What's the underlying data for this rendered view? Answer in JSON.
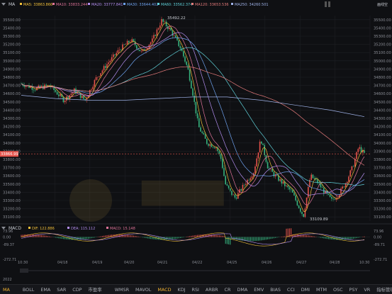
{
  "legend": {
    "indicator": "MA",
    "items": [
      {
        "label": "MA5: 33863.866",
        "color": "#f3c03a"
      },
      {
        "label": "MA10: 33833.244",
        "color": "#e1749a"
      },
      {
        "label": "MA20: 33777.841",
        "color": "#b48ef0"
      },
      {
        "label": "MA30: 33644.402",
        "color": "#6fa3f0"
      },
      {
        "label": "MA60: 33562.374",
        "color": "#5fd0d8"
      },
      {
        "label": "MA120: 33653.536",
        "color": "#e57b7b"
      },
      {
        "label": "MA250: 34260.501",
        "color": "#9fb2e8"
      }
    ],
    "right_btn": "画线空"
  },
  "price_axis": [
    "35500.00",
    "35400.00",
    "35300.00",
    "35200.00",
    "35100.00",
    "35000.00",
    "34900.00",
    "34800.00",
    "34700.00",
    "34600.00",
    "34500.00",
    "34400.00",
    "34300.00",
    "34200.00",
    "34100.00",
    "34000.00",
    "33900.00",
    "33800.00",
    "33700.00",
    "33600.00",
    "33500.00",
    "33400.00",
    "33300.00",
    "33200.00",
    "33100.00"
  ],
  "current_price": "33866.99",
  "annotations": {
    "high": "35492.22",
    "low": "33109.89"
  },
  "macd_legend": {
    "name": "MACD",
    "dif": "DIF: 122.886",
    "dea": "DEA: 115.112",
    "macd": "MACD: 15.148",
    "colors": {
      "dif": "#f3c03a",
      "dea": "#b48ef0",
      "macd": "#e1749a"
    }
  },
  "macd_axis_right": [
    "73.96",
    "0.00",
    "-89.71"
  ],
  "macd_axis_left": [
    "73.96",
    "0.00",
    "-89.37",
    "-272.71"
  ],
  "macd_axis_bottom_right": "-272.71",
  "time_axis": [
    "10:30",
    "04/18",
    "04/19",
    "04/20",
    "04/21",
    "04/22",
    "04/25",
    "04/26",
    "04/27",
    "04/28",
    "10:30"
  ],
  "year_label": "2022",
  "toolbar": {
    "items": [
      "MA",
      "BOLL",
      "EMA",
      "SAR",
      "CDP",
      "市盈率",
      "WMSR",
      "MAVOL",
      "MACD",
      "KDJ",
      "RSI",
      "ARBR",
      "CR",
      "DMA",
      "EMV",
      "BIAS",
      "CCI",
      "DMI",
      "MTM",
      "OSC",
      "PSY",
      "VR",
      "指标管理"
    ],
    "active": [
      "MA",
      "MACD"
    ]
  },
  "chart_data": {
    "type": "candlestick",
    "y_range": [
      33050,
      35550
    ],
    "key_points": {
      "high": 35492.22,
      "low": 33109.89,
      "last": 33866.99
    },
    "ma250_trend": [
      34580,
      34540,
      34520,
      34520,
      34540,
      34560,
      34560,
      34520,
      34460,
      34400,
      34320
    ],
    "macd_range": [
      -272.71,
      73.96
    ]
  }
}
